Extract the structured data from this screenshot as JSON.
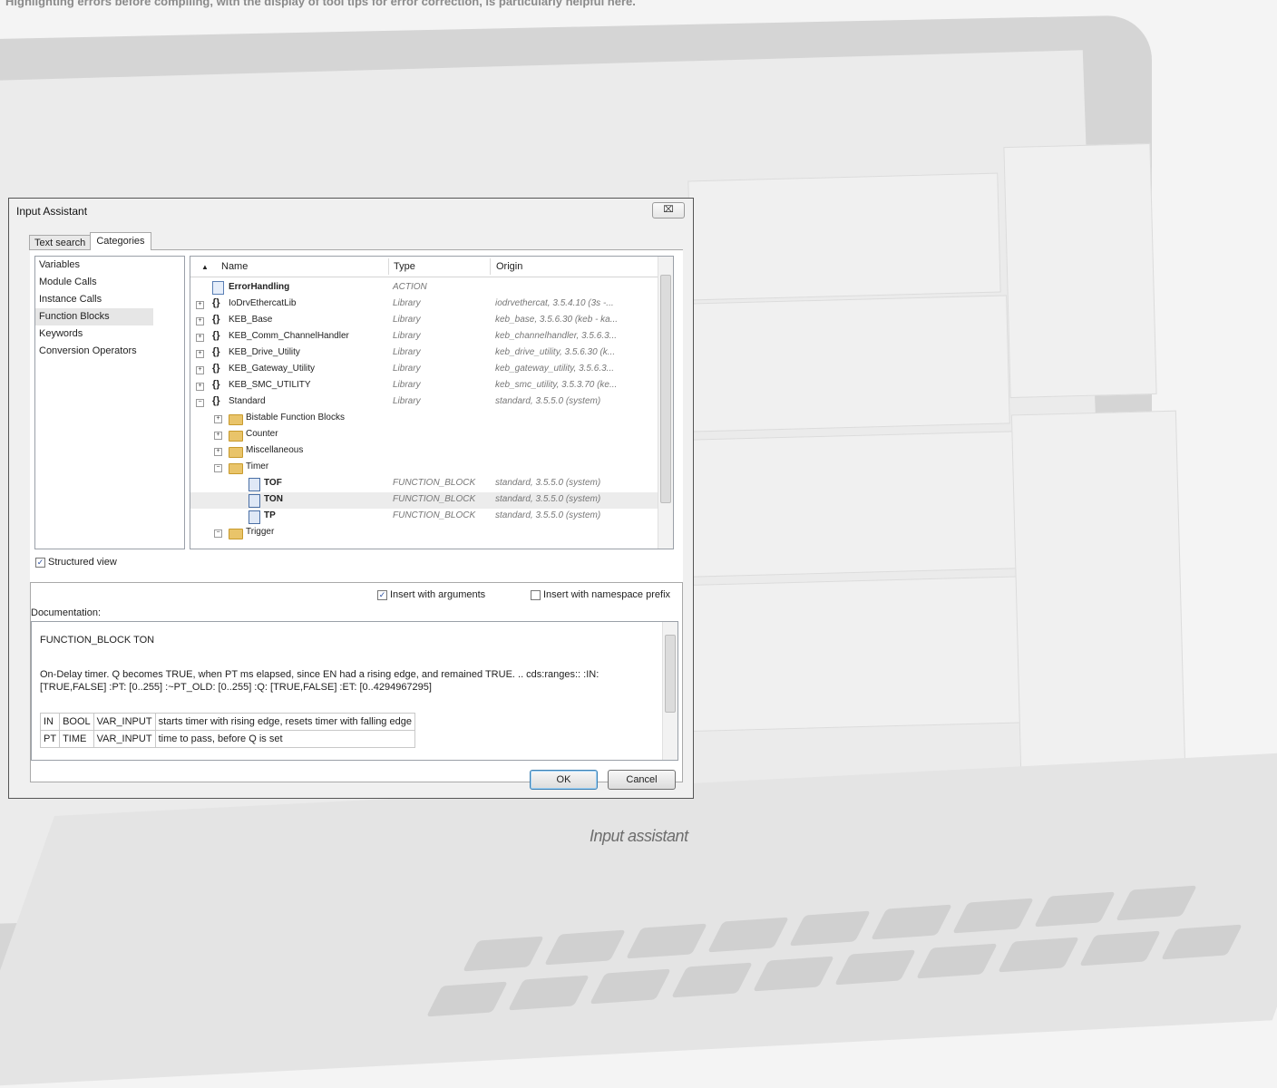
{
  "page": {
    "top_caption": "Highlighting errors before compiling, with the display of tool tips for error correction, is particularly helpful here.",
    "bottom_caption": "Input assistant"
  },
  "dialog": {
    "title": "Input Assistant",
    "close_label": "⌧",
    "tabs": [
      {
        "label": "Text search",
        "active": false
      },
      {
        "label": "Categories",
        "active": true
      }
    ],
    "categories": [
      {
        "label": "Variables",
        "selected": false
      },
      {
        "label": "Module Calls",
        "selected": false
      },
      {
        "label": "Instance Calls",
        "selected": false
      },
      {
        "label": "Function Blocks",
        "selected": true
      },
      {
        "label": "Keywords",
        "selected": false
      },
      {
        "label": "Conversion Operators",
        "selected": false
      }
    ],
    "tree": {
      "columns": {
        "name": "Name",
        "type": "Type",
        "origin": "Origin"
      },
      "sort_glyph": "▲",
      "rows": [
        {
          "name": "ErrorHandling",
          "type": "ACTION",
          "origin": ""
        },
        {
          "name": "IoDrvEthercatLib",
          "type": "Library",
          "origin": "iodrvethercat, 3.5.4.10 (3s -..."
        },
        {
          "name": "KEB_Base",
          "type": "Library",
          "origin": "keb_base, 3.5.6.30 (keb - ka..."
        },
        {
          "name": "KEB_Comm_ChannelHandler",
          "type": "Library",
          "origin": "keb_channelhandler, 3.5.6.3..."
        },
        {
          "name": "KEB_Drive_Utility",
          "type": "Library",
          "origin": "keb_drive_utility, 3.5.6.30 (k..."
        },
        {
          "name": "KEB_Gateway_Utility",
          "type": "Library",
          "origin": "keb_gateway_utility, 3.5.6.3..."
        },
        {
          "name": "KEB_SMC_UTILITY",
          "type": "Library",
          "origin": "keb_smc_utility, 3.5.3.70 (ke..."
        },
        {
          "name": "Standard",
          "type": "Library",
          "origin": "standard, 3.5.5.0 (system)"
        },
        {
          "name": "Bistable Function Blocks",
          "type": "",
          "origin": ""
        },
        {
          "name": "Counter",
          "type": "",
          "origin": ""
        },
        {
          "name": "Miscellaneous",
          "type": "",
          "origin": ""
        },
        {
          "name": "Timer",
          "type": "",
          "origin": ""
        },
        {
          "name": "TOF",
          "type": "FUNCTION_BLOCK",
          "origin": "standard, 3.5.5.0 (system)"
        },
        {
          "name": "TON",
          "type": "FUNCTION_BLOCK",
          "origin": "standard, 3.5.5.0 (system)"
        },
        {
          "name": "TP",
          "type": "FUNCTION_BLOCK",
          "origin": "standard, 3.5.5.0 (system)"
        },
        {
          "name": "Trigger",
          "type": "",
          "origin": ""
        }
      ]
    },
    "structured_view": {
      "label": "Structured view",
      "checked": true
    },
    "insert_with_arguments": {
      "label": "Insert with arguments",
      "checked": true
    },
    "insert_with_namespace": {
      "label": "Insert with namespace prefix",
      "checked": false
    },
    "documentation": {
      "label": "Documentation:",
      "heading": "FUNCTION_BLOCK TON",
      "description": "On-Delay timer. Q becomes TRUE, when PT ms elapsed, since EN had a rising edge, and remained TRUE. .. cds:ranges:: :IN: [TRUE,FALSE] :PT: [0..255] :~PT_OLD: [0..255] :Q: [TRUE,FALSE] :ET: [0..4294967295]",
      "params": [
        [
          "IN",
          "BOOL",
          "VAR_INPUT",
          "starts timer with rising edge, resets timer with falling edge"
        ],
        [
          "PT",
          "TIME",
          "VAR_INPUT",
          "time to pass, before Q is set"
        ]
      ]
    },
    "ok_label": "OK",
    "cancel_label": "Cancel"
  },
  "colors": {
    "folder": "#e9c46a",
    "selection": "#e6e6e6",
    "primary_border": "#3c7fb1"
  },
  "icons": {
    "library": "braces-icon",
    "folder": "folder-icon",
    "function_block": "function-block-icon",
    "action": "action-icon"
  }
}
